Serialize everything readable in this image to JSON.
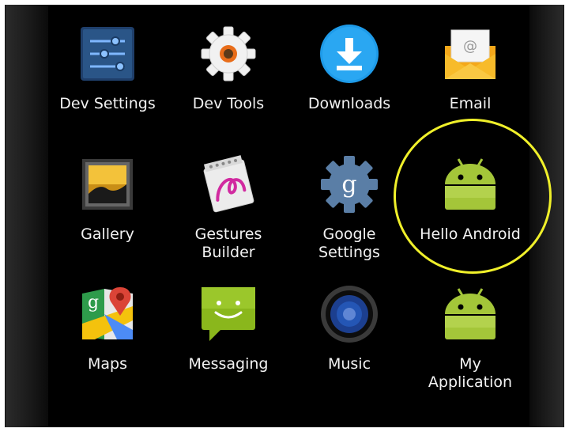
{
  "apps": [
    {
      "label": "Dev Settings",
      "icon": "sliders-icon"
    },
    {
      "label": "Dev Tools",
      "icon": "gear-icon"
    },
    {
      "label": "Downloads",
      "icon": "download-icon"
    },
    {
      "label": "Email",
      "icon": "envelope-icon"
    },
    {
      "label": "Gallery",
      "icon": "picture-icon"
    },
    {
      "label": "Gestures\nBuilder",
      "icon": "gesture-icon"
    },
    {
      "label": "Google\nSettings",
      "icon": "google-gear-icon"
    },
    {
      "label": "Hello Android",
      "icon": "android-icon"
    },
    {
      "label": "Maps",
      "icon": "maps-icon"
    },
    {
      "label": "Messaging",
      "icon": "message-icon"
    },
    {
      "label": "Music",
      "icon": "speaker-icon"
    },
    {
      "label": "My\nApplication",
      "icon": "android-icon"
    }
  ],
  "highlight_color": "#f0f02a",
  "background_color": "#000000"
}
